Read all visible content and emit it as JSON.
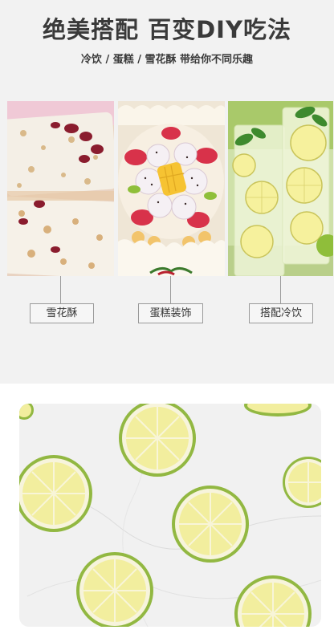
{
  "header": {
    "title": "绝美搭配 百变DIY吃法",
    "subtitle": "冷饮 / 蛋糕 / 雪花酥 带给你不同乐趣"
  },
  "uses": [
    {
      "label": "雪花酥",
      "image": "nougat-snowflake-crisp-photo"
    },
    {
      "label": "蛋糕装饰",
      "image": "fruit-cake-photo"
    },
    {
      "label": "搭配冷饮",
      "image": "lemon-mint-drink-photo"
    }
  ],
  "product_photo": {
    "image": "dried-lemon-slices-on-marble-photo"
  },
  "colors": {
    "panel_bg": "#f2f2f2",
    "text": "#3a3a3a",
    "lemon": "#f3f0a8",
    "rind": "#8fb13b"
  }
}
